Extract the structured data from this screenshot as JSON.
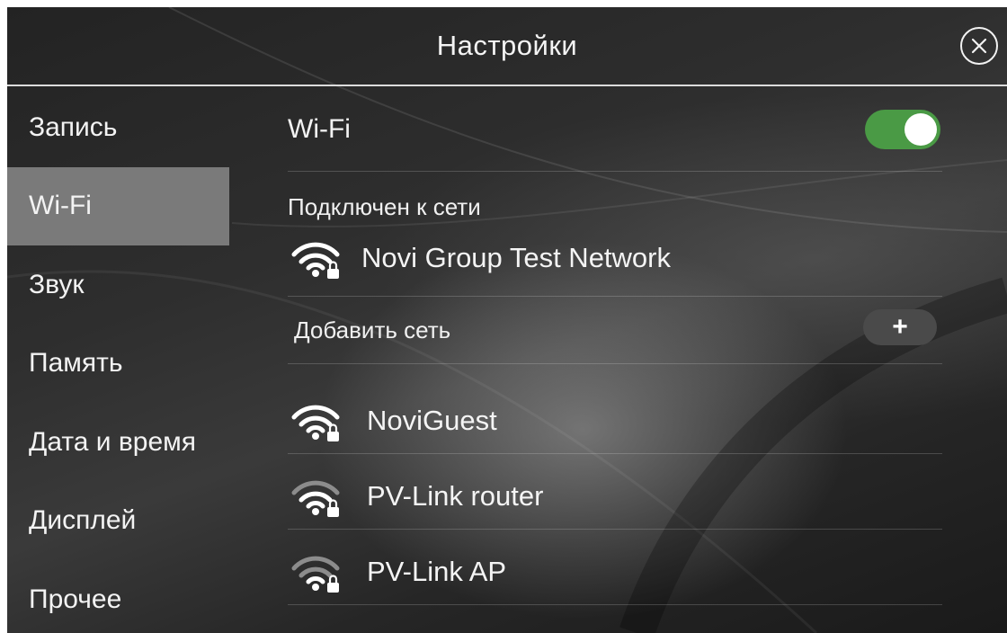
{
  "header": {
    "title": "Настройки",
    "close_icon": "close-circle-icon"
  },
  "sidebar": {
    "items": [
      {
        "label": "Запись",
        "active": false
      },
      {
        "label": "Wi-Fi",
        "active": true
      },
      {
        "label": "Звук",
        "active": false
      },
      {
        "label": "Память",
        "active": false
      },
      {
        "label": "Дата и время",
        "active": false
      },
      {
        "label": "Дисплей",
        "active": false
      },
      {
        "label": "Прочее",
        "active": false
      }
    ]
  },
  "wifi": {
    "toggle_label": "Wi-Fi",
    "enabled": true,
    "toggle_color": "#4a9a45",
    "connected_caption": "Подключен к сети",
    "connected_network": {
      "name": "Novi Group Test Network",
      "icon": "wifi-lock-icon",
      "signal": "strong"
    },
    "add_caption": "Добавить сеть",
    "add_button_label": "+",
    "networks": [
      {
        "name": "NoviGuest",
        "icon": "wifi-lock-icon",
        "signal": "strong"
      },
      {
        "name": "PV-Link router",
        "icon": "wifi-lock-icon",
        "signal": "weak"
      },
      {
        "name": "PV-Link AP",
        "icon": "wifi-lock-icon",
        "signal": "weak"
      }
    ]
  }
}
